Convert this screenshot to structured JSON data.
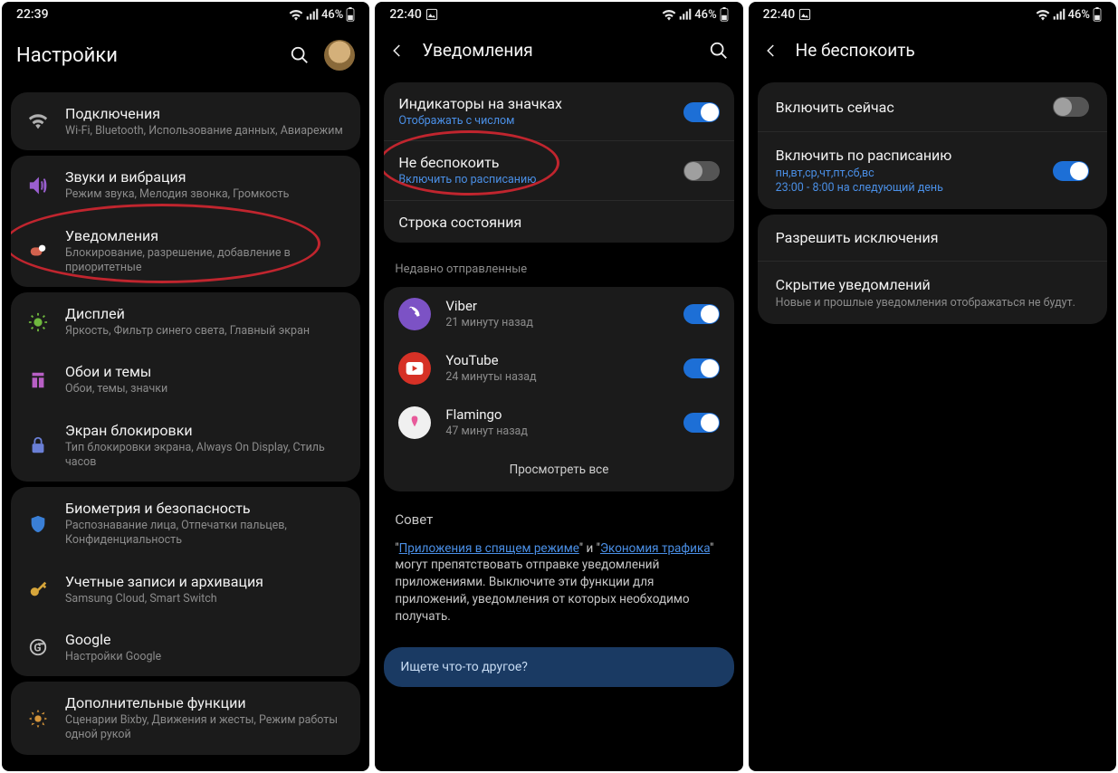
{
  "screens": {
    "a": {
      "status": {
        "time": "22:39",
        "battery": "46%"
      },
      "title": "Настройки",
      "groups": [
        [
          {
            "icon": "wifi",
            "label": "Подключения",
            "sub": "Wi-Fi, Bluetooth, Использование данных, Авиарежим"
          }
        ],
        [
          {
            "icon": "sound",
            "label": "Звуки и вибрация",
            "sub": "Режим звука, Мелодия звонка, Громкость"
          },
          {
            "icon": "notif",
            "label": "Уведомления",
            "sub": "Блокирование, разрешение, добавление в приоритетные",
            "highlighted": true
          }
        ],
        [
          {
            "icon": "display",
            "label": "Дисплей",
            "sub": "Яркость, Фильтр синего света, Главный экран"
          },
          {
            "icon": "wallpaper",
            "label": "Обои и темы",
            "sub": "Обои, темы, значки"
          },
          {
            "icon": "lock",
            "label": "Экран блокировки",
            "sub": "Тип блокировки экрана, Always On Display, Стиль часов"
          }
        ],
        [
          {
            "icon": "bio",
            "label": "Биометрия и безопасность",
            "sub": "Распознавание лица, Отпечатки пальцев, Конфиденциальность"
          },
          {
            "icon": "key",
            "label": "Учетные записи и архивация",
            "sub": "Samsung Cloud, Smart Switch"
          },
          {
            "icon": "google",
            "label": "Google",
            "sub": "Настройки Google"
          }
        ],
        [
          {
            "icon": "adv",
            "label": "Дополнительные функции",
            "sub": "Сценарии Bixby, Движения и жесты, Режим работы одной рукой"
          }
        ]
      ]
    },
    "b": {
      "status": {
        "time": "22:40",
        "battery": "46%",
        "screenshot": true
      },
      "title": "Уведомления",
      "items": [
        {
          "label": "Индикаторы на значках",
          "sub": "Отображать с числом",
          "subBlue": true,
          "toggle": "on"
        },
        {
          "label": "Не беспокоить",
          "sub": "Включить по расписанию",
          "subBlue": true,
          "toggle": "off",
          "highlighted": true
        },
        {
          "label": "Строка состояния"
        }
      ],
      "recentHeader": "Недавно отправленные",
      "apps": [
        {
          "name": "Viber",
          "time": "21 минуту назад",
          "color": "#7c52c5",
          "toggle": "on"
        },
        {
          "name": "YouTube",
          "time": "24 минуты назад",
          "color": "#d63126",
          "toggle": "on"
        },
        {
          "name": "Flamingo",
          "time": "47 минут назад",
          "color": "#f0f0f0",
          "toggle": "on"
        }
      ],
      "viewAll": "Просмотреть все",
      "tipTitle": "Совет",
      "tipLinks": {
        "l1": "Приложения в спящем режиме",
        "l2": "Экономия трафика"
      },
      "tipRest1": "\" и \"",
      "tipRest2": "\" могут препятствовать отправке уведомлений приложениями. Выключите эти функции для приложений, уведомления от которых необходимо получать.",
      "searchPrompt": "Ищете что-то другое?"
    },
    "c": {
      "status": {
        "time": "22:40",
        "battery": "46%",
        "screenshot": true
      },
      "title": "Не беспокоить",
      "rows": [
        {
          "label": "Включить сейчас",
          "toggle": "off"
        },
        {
          "label": "Включить по расписанию",
          "s1": "пн,вт,ср,чт,пт,сб,вс",
          "s2": "23:00 - 8:00 на следующий день",
          "toggle": "on"
        }
      ],
      "rows2": [
        {
          "label": "Разрешить исключения"
        },
        {
          "label": "Скрытие уведомлений",
          "note": "Новые и прошлые уведомления отображаться не будут."
        }
      ]
    }
  }
}
